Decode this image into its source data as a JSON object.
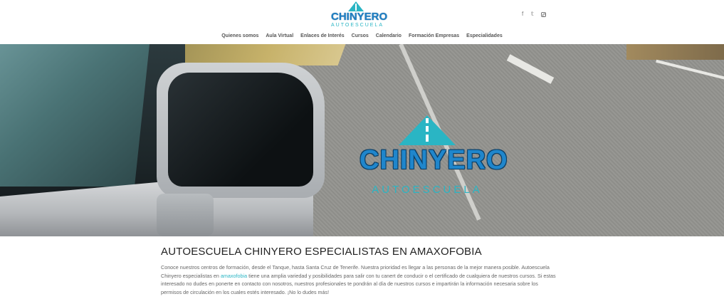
{
  "header": {
    "logo": {
      "main": "CHINYERO",
      "sub": "AUTOESCUELA"
    },
    "social": [
      {
        "name": "facebook",
        "glyph": "f"
      },
      {
        "name": "twitter",
        "glyph": "𝕥"
      },
      {
        "name": "instagram",
        "glyph": ""
      }
    ],
    "nav": [
      "Quienes somos",
      "Aula Virtual",
      "Enlaces de Interés",
      "Cursos",
      "Calendario",
      "Formación Empresas",
      "Especialidades"
    ]
  },
  "hero": {
    "logo_main": "CHINYERO",
    "logo_sub": "AUTOESCUELA"
  },
  "content": {
    "title": "AUTOESCUELA CHINYERO ESPECIALISTAS EN AMAXOFOBIA",
    "p1_a": "Conoce nuestros centros de formación, desde el Tanque, hasta Santa Cruz de Tenerife. Nuestra prioridad es llegar a las personas de la mejor manera posible. Autoescuela Chinyero especialistas en ",
    "p1_link": "amaxofobia",
    "p1_b": " tiene una amplia variedad y posibilidades para salir con tu canert de conducir o el certificado de cualquiera de nuestros cursos.  Si estas interesado no dudes en ponerte en contacto con nosotros, nuestros profesionales te pondrán al día de nuestros cursos e impartirán la información necesaria sobre los permisos de circulación en los cuales estés interesado. ¡No lo dudes más!"
  },
  "colors": {
    "brand_blue": "#1f86cc",
    "brand_teal": "#2ab5c4"
  }
}
